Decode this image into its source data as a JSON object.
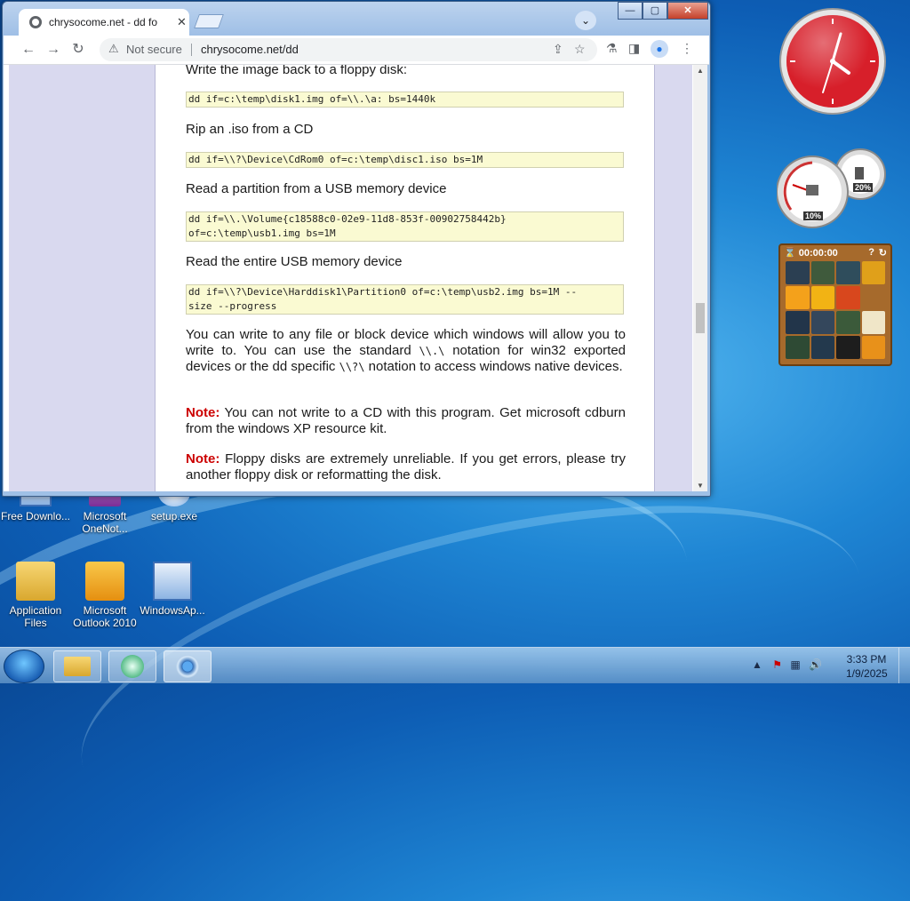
{
  "browser": {
    "tab_title": "chrysocome.net - dd fo",
    "tab_close": "✕",
    "url_warning": "Not secure",
    "url": "chrysocome.net/dd",
    "buttons": {
      "minimize": "—",
      "maximize": "▢",
      "close": "✕"
    },
    "tab_search": "⌄"
  },
  "page": {
    "p_write_floppy": "Write the image back to a floppy disk:",
    "code_write_floppy": "dd if=c:\\temp\\disk1.img of=\\\\.\\a: bs=1440k",
    "p_rip_iso": "Rip an .iso from a CD",
    "code_rip_iso": "dd if=\\\\?\\Device\\CdRom0 of=c:\\temp\\disc1.iso bs=1M",
    "p_read_partition": "Read a partition from a USB memory device",
    "code_read_partition": "dd if=\\\\.\\Volume{c18588c0-02e9-11d8-853f-00902758442b}\nof=c:\\temp\\usb1.img bs=1M",
    "p_read_usb": "Read the entire USB memory device",
    "code_read_usb": "dd if=\\\\?\\Device\\Harddisk1\\Partition0 of=c:\\temp\\usb2.img bs=1M --\nsize --progress",
    "p_write_any_1": "You can write to any file or block device which windows will allow you to write to. You can use the standard ",
    "p_write_any_code1": "\\\\.\\",
    "p_write_any_2": " notation for win32 exported devices or the dd specific ",
    "p_write_any_code2": "\\\\?\\",
    "p_write_any_3": " notation to access windows native devices.",
    "note_label": "Note:",
    "note_cd": " You can not write to a CD with this program. Get microsoft cdburn from the windows XP resource kit.",
    "note_floppy": " Floppy disks are extremely unreliable. If you get errors, please try another floppy disk or reformatting the disk."
  },
  "desktop": {
    "icons": [
      {
        "label": "Free Downlo..."
      },
      {
        "label": "Microsoft OneNot..."
      },
      {
        "label": "setup.exe"
      },
      {
        "label": "Application Files"
      },
      {
        "label": "Microsoft Outlook 2010"
      },
      {
        "label": "WindowsAp..."
      }
    ]
  },
  "gadgets": {
    "meter_cpu": "10%",
    "meter_mem": "20%",
    "puzzle_time": "00:00:00"
  },
  "taskbar": {
    "time": "3:33 PM",
    "date": "1/9/2025"
  }
}
